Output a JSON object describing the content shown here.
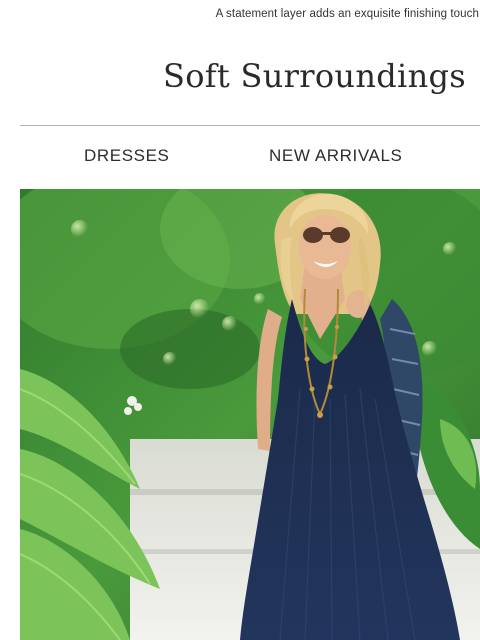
{
  "preheader": {
    "text": "A statement layer adds an exquisite finishing touch"
  },
  "brand": {
    "logo_text": "Soft Surroundings"
  },
  "nav": {
    "items": [
      {
        "label": "DRESSES"
      },
      {
        "label": "NEW ARRIVALS"
      }
    ]
  },
  "hero": {
    "icon": "model-photo",
    "colors": {
      "foliage": "#3f8f3a",
      "foliage_light": "#7fc75a",
      "dress": "#1f2f52",
      "wall": "#e6e6e0",
      "skin": "#e2b08c",
      "hair": "#e4c98c"
    }
  }
}
